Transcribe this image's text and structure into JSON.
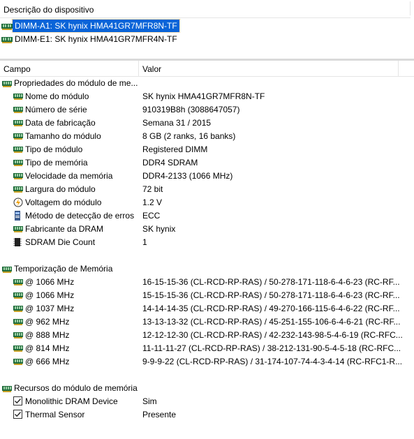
{
  "top": {
    "header": "Descrição do dispositivo"
  },
  "devices": [
    {
      "label": "DIMM-A1: SK hynix HMA41GR7MFR8N-TF",
      "selected": true
    },
    {
      "label": "DIMM-E1: SK hynix HMA41GR7MFR4N-TF",
      "selected": false
    }
  ],
  "grid": {
    "col_field": "Campo",
    "col_value": "Valor"
  },
  "groups": {
    "props": "Propriedades do módulo de me...",
    "timing": "Temporização de Memória",
    "features": "Recursos do módulo de memória"
  },
  "props": [
    {
      "field": "Nome do módulo",
      "value": "SK hynix HMA41GR7MFR8N-TF",
      "icon": "ram-icon"
    },
    {
      "field": "Número de série",
      "value": "910319B8h (3088647057)",
      "icon": "ram-icon"
    },
    {
      "field": "Data de fabricação",
      "value": "Semana 31 / 2015",
      "icon": "ram-icon"
    },
    {
      "field": "Tamanho do módulo",
      "value": "8 GB (2 ranks, 16 banks)",
      "icon": "ram-icon"
    },
    {
      "field": "Tipo de módulo",
      "value": "Registered DIMM",
      "icon": "ram-icon"
    },
    {
      "field": "Tipo de memória",
      "value": "DDR4 SDRAM",
      "icon": "ram-icon"
    },
    {
      "field": "Velocidade da memória",
      "value": "DDR4-2133 (1066 MHz)",
      "icon": "ram-icon"
    },
    {
      "field": "Largura do módulo",
      "value": "72 bit",
      "icon": "ram-icon"
    },
    {
      "field": "Voltagem do módulo",
      "value": "1.2 V",
      "icon": "voltage-icon"
    },
    {
      "field": "Método de detecção de erros",
      "value": "ECC",
      "icon": "error-detection-icon"
    },
    {
      "field": "Fabricante da DRAM",
      "value": "SK hynix",
      "icon": "ram-icon"
    },
    {
      "field": "SDRAM Die Count",
      "value": "1",
      "icon": "chip-icon"
    }
  ],
  "timing": [
    {
      "field": "@ 1066 MHz",
      "value": "16-15-15-36  (CL-RCD-RP-RAS) / 50-278-171-118-6-4-6-23  (RC-RF..."
    },
    {
      "field": "@ 1066 MHz",
      "value": "15-15-15-36  (CL-RCD-RP-RAS) / 50-278-171-118-6-4-6-23  (RC-RF..."
    },
    {
      "field": "@ 1037 MHz",
      "value": "14-14-14-35  (CL-RCD-RP-RAS) / 49-270-166-115-6-4-6-22  (RC-RF..."
    },
    {
      "field": "@ 962 MHz",
      "value": "13-13-13-32  (CL-RCD-RP-RAS) / 45-251-155-106-6-4-6-21  (RC-RF..."
    },
    {
      "field": "@ 888 MHz",
      "value": "12-12-12-30  (CL-RCD-RP-RAS) / 42-232-143-98-5-4-6-19  (RC-RFC..."
    },
    {
      "field": "@ 814 MHz",
      "value": "11-11-11-27  (CL-RCD-RP-RAS) / 38-212-131-90-5-4-5-18  (RC-RFC..."
    },
    {
      "field": "@ 666 MHz",
      "value": "9-9-9-22  (CL-RCD-RP-RAS) / 31-174-107-74-4-3-4-14  (RC-RFC1-R..."
    }
  ],
  "features": [
    {
      "field": "Monolithic DRAM Device",
      "value": "Sim",
      "icon": "checkbox-icon"
    },
    {
      "field": "Thermal Sensor",
      "value": "Presente",
      "icon": "checkbox-icon"
    }
  ],
  "colors": {
    "selection": "#0a64d8",
    "ram_green": "#1f6b3a"
  }
}
